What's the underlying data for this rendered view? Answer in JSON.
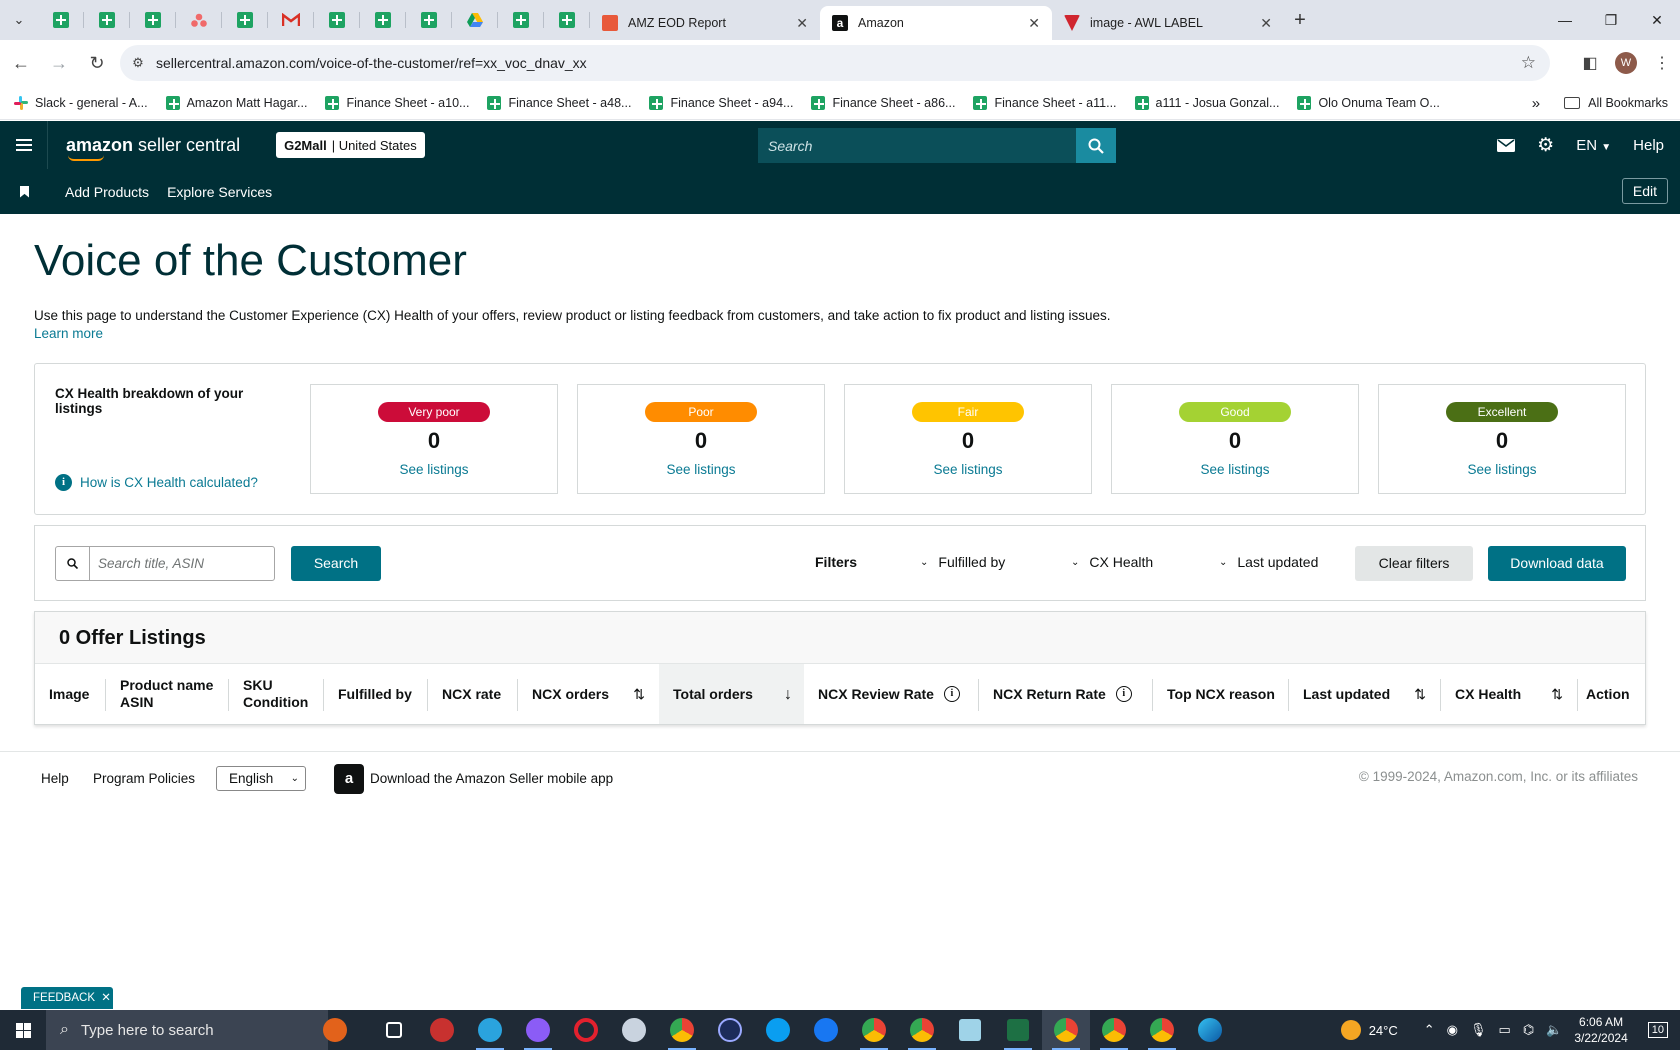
{
  "browser": {
    "tabs": [
      {
        "title": "AMZ EOD Report",
        "favicon": "#e8593a"
      },
      {
        "title": "Amazon",
        "favicon": "#0f1111",
        "active": true
      },
      {
        "title": "image - AWL LABEL",
        "favicon": "#d0262f"
      }
    ],
    "url": "sellercentral.amazon.com/voice-of-the-customer/ref=xx_voc_dnav_xx",
    "avatar_letter": "W",
    "bookmarks": [
      {
        "label": "Slack - general - A...",
        "icon": "slack-icon"
      },
      {
        "label": "Amazon Matt Hagar...",
        "icon": "sheets-icon"
      },
      {
        "label": "Finance Sheet - a10...",
        "icon": "sheets-icon"
      },
      {
        "label": "Finance Sheet - a48...",
        "icon": "sheets-icon"
      },
      {
        "label": "Finance Sheet - a94...",
        "icon": "sheets-icon"
      },
      {
        "label": "Finance Sheet - a86...",
        "icon": "sheets-icon"
      },
      {
        "label": "Finance Sheet - a11...",
        "icon": "sheets-icon"
      },
      {
        "label": "a111 - Josua Gonzal...",
        "icon": "sheets-icon"
      },
      {
        "label": "Olo Onuma Team O...",
        "icon": "sheets-icon"
      }
    ],
    "all_bookmarks": "All Bookmarks"
  },
  "header": {
    "logo_bold": "amazon",
    "logo_rest": " seller central",
    "store_name": "G2Mall",
    "store_region": "| United States",
    "search_placeholder": "Search",
    "language": "EN",
    "help": "Help"
  },
  "subnav": {
    "links": [
      "Add Products",
      "Explore Services"
    ],
    "edit": "Edit"
  },
  "page": {
    "title": "Voice of the Customer",
    "description": "Use this page to understand the Customer Experience (CX) Health of your offers, review product or listing feedback from customers, and take action to fix product and listing issues.",
    "learn_more": "Learn more"
  },
  "health": {
    "title": "CX Health breakdown of your listings",
    "help_link": "How is CX Health calculated?",
    "cards": [
      {
        "label": "Very poor",
        "count": "0",
        "link": "See listings",
        "bg": "#cc0c39",
        "fg": "#ffffff"
      },
      {
        "label": "Poor",
        "count": "0",
        "link": "See listings",
        "bg": "#ff8c00",
        "fg": "#ffffff"
      },
      {
        "label": "Fair",
        "count": "0",
        "link": "See listings",
        "bg": "#ffc400",
        "fg": "#ffffff"
      },
      {
        "label": "Good",
        "count": "0",
        "link": "See listings",
        "bg": "#a4d233",
        "fg": "#ffffff"
      },
      {
        "label": "Excellent",
        "count": "0",
        "link": "See listings",
        "bg": "#4b6f15",
        "fg": "#ffffff"
      }
    ]
  },
  "filters": {
    "search_placeholder": "Search title, ASIN",
    "search_button": "Search",
    "label": "Filters",
    "dropdowns": [
      "Fulfilled by",
      "CX Health",
      "Last updated"
    ],
    "clear": "Clear filters",
    "download": "Download data"
  },
  "table": {
    "title": "0 Offer Listings",
    "columns": {
      "image": "Image",
      "product_line1": "Product name",
      "product_line2": "ASIN",
      "sku_line1": "SKU",
      "sku_line2": "Condition",
      "fulfilled": "Fulfilled by",
      "ncx_rate": "NCX rate",
      "ncx_orders": "NCX orders",
      "total_orders": "Total orders",
      "review_rate": "NCX Review Rate",
      "return_rate": "NCX Return Rate",
      "top_reason": "Top NCX reason",
      "last_updated": "Last updated",
      "cx_health": "CX Health",
      "action": "Action"
    }
  },
  "footer": {
    "help": "Help",
    "policies": "Program Policies",
    "language": "English",
    "app_text": "Download the Amazon Seller mobile app",
    "copyright": "© 1999-2024, Amazon.com, Inc. or its affiliates"
  },
  "feedback": "FEEDBACK",
  "taskbar": {
    "search_placeholder": "Type here to search",
    "temperature": "24°C",
    "time": "6:06 AM",
    "date": "3/22/2024",
    "notifications": "10"
  }
}
